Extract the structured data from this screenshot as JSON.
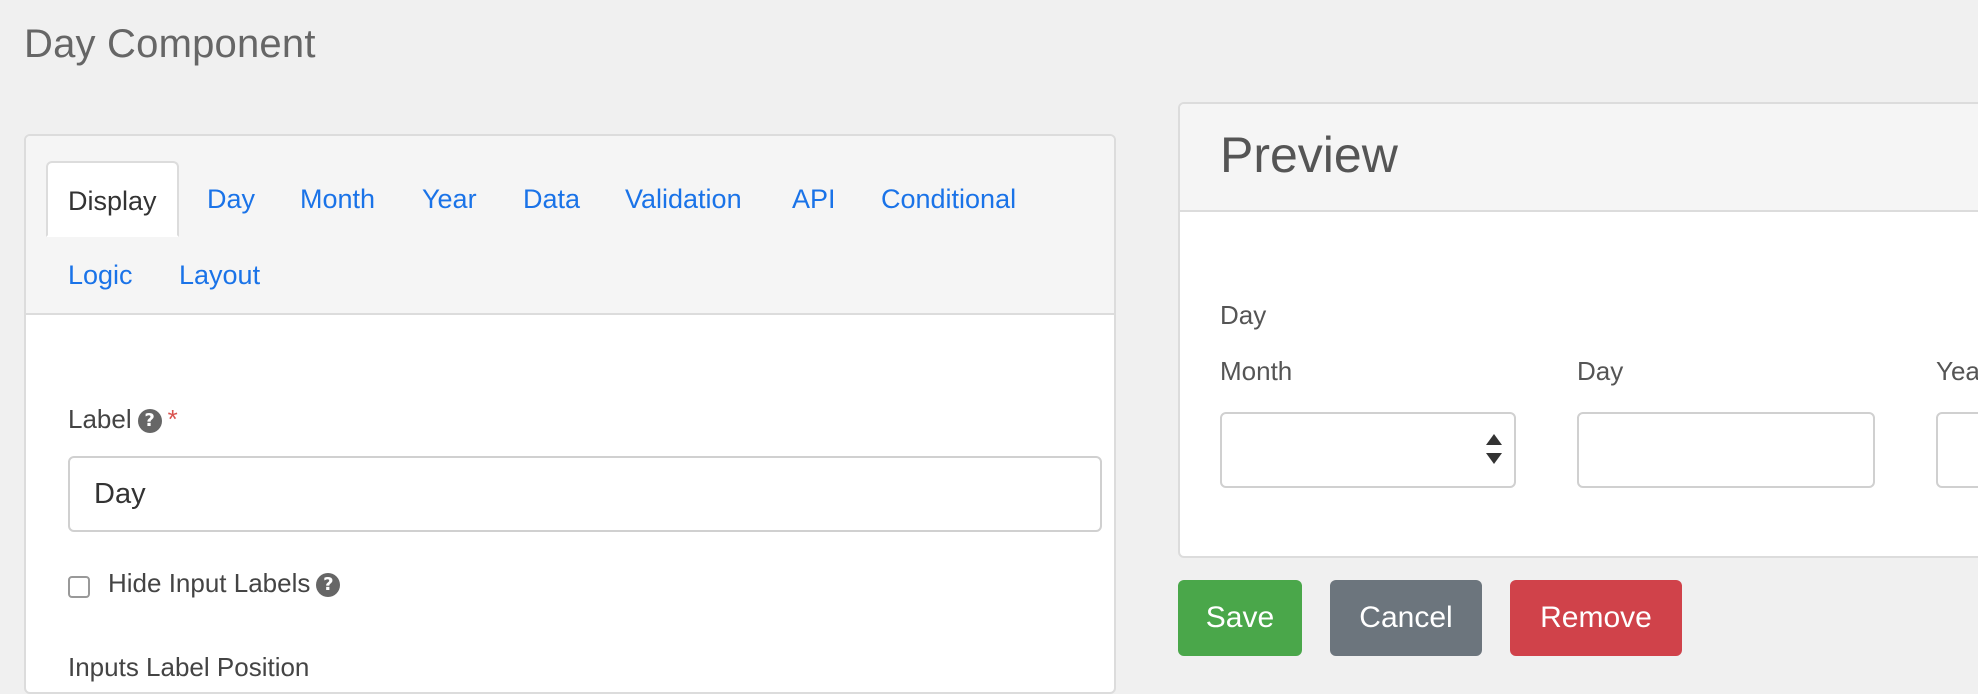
{
  "dialog": {
    "title": "Day Component"
  },
  "tabs": [
    {
      "label": "Display",
      "active": true
    },
    {
      "label": "Day"
    },
    {
      "label": "Month"
    },
    {
      "label": "Year"
    },
    {
      "label": "Data"
    },
    {
      "label": "Validation"
    },
    {
      "label": "API"
    },
    {
      "label": "Conditional"
    },
    {
      "label": "Logic"
    },
    {
      "label": "Layout"
    }
  ],
  "form": {
    "label_field": {
      "label": "Label",
      "required_mark": "*",
      "value": "Day"
    },
    "hide_input_labels": {
      "label": "Hide Input Labels",
      "checked": false
    },
    "next_field_label": "Inputs Label Position"
  },
  "preview": {
    "title": "Preview",
    "component_label": "Day",
    "month_label": "Month",
    "day_label": "Day",
    "year_label": "Yea"
  },
  "buttons": {
    "save": "Save",
    "cancel": "Cancel",
    "remove": "Remove"
  },
  "colors": {
    "link": "#1a73e8",
    "save": "#4aa74a",
    "cancel": "#6c757d",
    "remove": "#d0424a",
    "required": "#d9534f"
  },
  "icons": {
    "help": "question-circle-icon",
    "select_arrows": "up-down-arrows-icon"
  }
}
